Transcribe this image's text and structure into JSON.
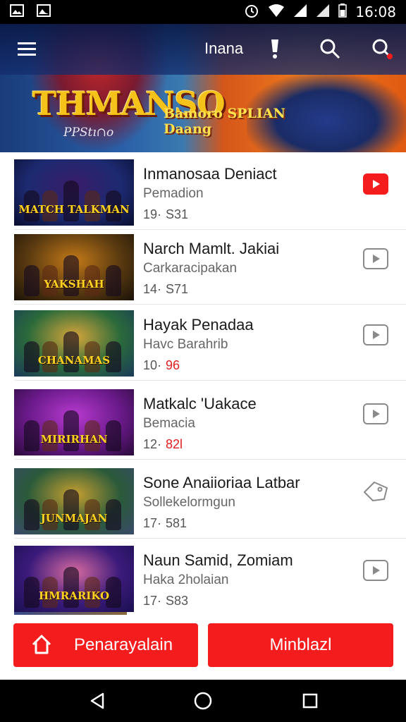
{
  "status_bar": {
    "time": "16:08",
    "icons": [
      "image-icon",
      "image-icon",
      "alarm-icon",
      "wifi-icon",
      "signal-icon",
      "signal-icon",
      "battery-icon"
    ]
  },
  "header": {
    "title": "Inana",
    "banner_logo": "THMANSO",
    "banner_sub": "PPStı∩o",
    "banner_tag_line1": "Bamoro SPLIAN",
    "banner_tag_line2": "Daang",
    "icons": [
      "menu-icon",
      "exclamation-icon",
      "search-icon",
      "search-notification-icon"
    ]
  },
  "list": {
    "items": [
      {
        "title": "Inmanosaa Deniact",
        "subtitle": "Pemadion",
        "meta_a": "19·",
        "meta_b": "S31",
        "meta_highlight": false,
        "thumb_label": "MATCH TALKMAN",
        "action_icon": "play-icon",
        "action_active": true,
        "thumb_colors": [
          "#1c2a70",
          "#3a1c6a",
          "#0a0e30"
        ]
      },
      {
        "title": "Narch Mamlt. Jakiai",
        "subtitle": "Carkaracipakan",
        "meta_a": "14·",
        "meta_b": "S71",
        "meta_highlight": false,
        "thumb_label": "YAKSHAH",
        "action_icon": "play-icon",
        "action_active": false,
        "thumb_colors": [
          "#5a3a10",
          "#c47a18",
          "#1a1208"
        ]
      },
      {
        "title": "Hayak Penadaa",
        "subtitle": "Havc Barahrib",
        "meta_a": "10·",
        "meta_b": "96",
        "meta_highlight": true,
        "thumb_label": "CHANAMAS",
        "action_icon": "play-icon",
        "action_active": false,
        "thumb_colors": [
          "#2a6a3a",
          "#d8a63a",
          "#1a3a5a"
        ]
      },
      {
        "title": "Matkalc 'Uakace",
        "subtitle": "Bemacia",
        "meta_a": "12·",
        "meta_b": "82l",
        "meta_highlight": true,
        "thumb_label": "MIRIRHAN",
        "action_icon": "play-icon",
        "action_active": false,
        "thumb_colors": [
          "#6a1a8a",
          "#b83ad0",
          "#2a0a3a"
        ]
      },
      {
        "title": "Sone Anaiioriaa Latbar",
        "subtitle": "Sollekelormgun",
        "meta_a": "17·",
        "meta_b": "581",
        "meta_highlight": false,
        "thumb_label": "JUNMAJAN",
        "action_icon": "tag-icon",
        "action_active": false,
        "thumb_colors": [
          "#2a5a3a",
          "#c8a030",
          "#3a4a6a"
        ]
      },
      {
        "title": "Naun Samid, Zomiam",
        "subtitle": "Haka 2holaian",
        "meta_a": "17·",
        "meta_b": "S83",
        "meta_highlight": false,
        "thumb_label": "HMRARIKO",
        "action_icon": "play-icon",
        "action_active": false,
        "thumb_colors": [
          "#3a1a7a",
          "#d86aa0",
          "#1a1050"
        ]
      }
    ]
  },
  "bottom": {
    "left_label": "Penarayalain",
    "right_label": "Minblazl"
  },
  "colors": {
    "accent": "#f41c1c",
    "text_primary": "#1a1a1a",
    "text_secondary": "#666666"
  }
}
